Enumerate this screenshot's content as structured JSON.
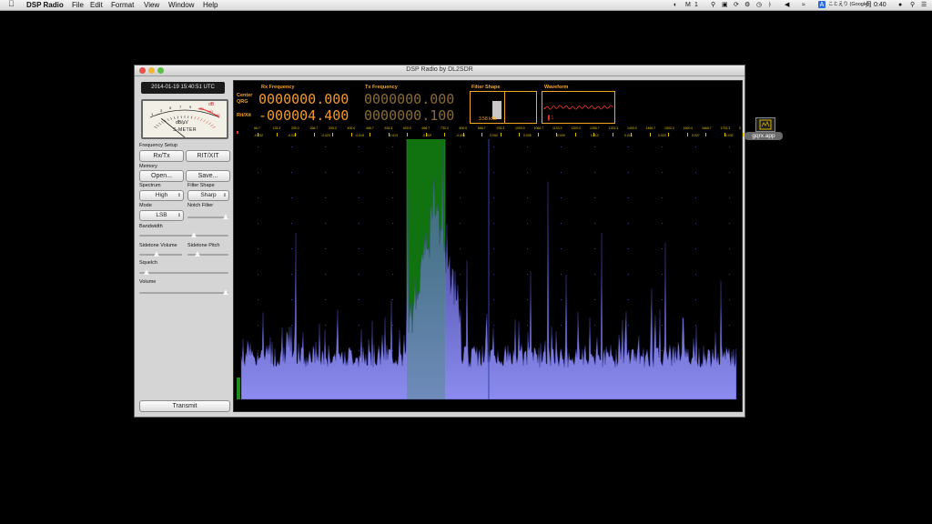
{
  "menubar": {
    "app_name": "DSP Radio",
    "items": [
      "File",
      "Edit",
      "Format",
      "View",
      "Window",
      "Help"
    ],
    "status": {
      "input_indicator": "1",
      "ime_label": "ことえり (Google)",
      "day": "月",
      "time": "0:40"
    }
  },
  "window": {
    "title": "DSP Radio by DL2SDR"
  },
  "left_panel": {
    "clock": "2014-01-19 15:40:51 UTC",
    "smeter": {
      "unit_label": "dB/μV",
      "title": "S-METER",
      "scale": [
        "1",
        "3",
        "5",
        "7",
        "9",
        "+20",
        "+40",
        "+60"
      ],
      "db_label": "dB",
      "level": 0.15
    },
    "frequency_setup_label": "Frequency Setup",
    "rx_tx_button": "Rx/Tx",
    "rit_xit_button": "RIT/XIT",
    "memory_label": "Memory",
    "open_button": "Open...",
    "save_button": "Save...",
    "spectrum_label": "Spectrum",
    "spectrum_value": "High",
    "filter_shape_label": "Filter Shape",
    "filter_shape_value": "Sharp",
    "mode_label": "Mode",
    "mode_value": "LSB",
    "notch_filter_label": "Notch Filter",
    "bandwidth_label": "Bandwidth",
    "sidetone_volume_label": "Sidetone Volume",
    "sidetone_pitch_label": "Sidetone Pitch",
    "squelch_label": "Squelch",
    "volume_label": "Volume",
    "transmit_button": "Transmit",
    "slider_levels": {
      "notch": 1.0,
      "bandwidth": 0.62,
      "sidetone_volume": 0.4,
      "sidetone_pitch": 0.2,
      "squelch": 0.05,
      "volume": 1.0
    }
  },
  "display": {
    "rx_frequency_label": "Rx Frequency",
    "tx_frequency_label": "Tx Frequency",
    "center_qrg_label_1": "Center",
    "center_qrg_label_2": "QRG",
    "rit_xit_label": "Rit/Xit",
    "rx_frequency": "0000000.000",
    "rx_offset": "-000004.400",
    "tx_frequency": "0000000.000",
    "tx_offset": "0000000.100",
    "filter_shape_title": "Filter Shape",
    "filter_bandwidth": "3.58 kHz",
    "waveform_title": "Waveform",
    "scale_top": [
      "66.7",
      "133.3",
      "200.0",
      "266.7",
      "333.3",
      "400.0",
      "466.7",
      "533.3",
      "600.0",
      "666.7",
      "733.3",
      "800.0",
      "866.7",
      "933.3",
      "1000.0",
      "1066.7",
      "1133.3",
      "1200.0",
      "1266.7",
      "1333.3",
      "1400.0",
      "1466.7",
      "1533.3",
      "1600.0",
      "1666.7",
      "1733.3",
      "0"
    ],
    "scale_bottom": [
      "-0.032",
      "-0.027",
      "-0.023",
      "-0.018",
      "-0.013",
      "-0.009",
      "-0.005",
      "0.000",
      "0.005",
      "0.009",
      "0.013",
      "0.018",
      "0.023",
      "0.027",
      "0.032"
    ],
    "colors": {
      "rx_frequency": "#f39a2b",
      "tx_frequency": "#8a6a3a",
      "spectrum": "#6d6dd8",
      "passband": "#0c6b0c",
      "marker": "#3344aa"
    }
  },
  "desktop": {
    "icon_label": "gqrx.app"
  }
}
